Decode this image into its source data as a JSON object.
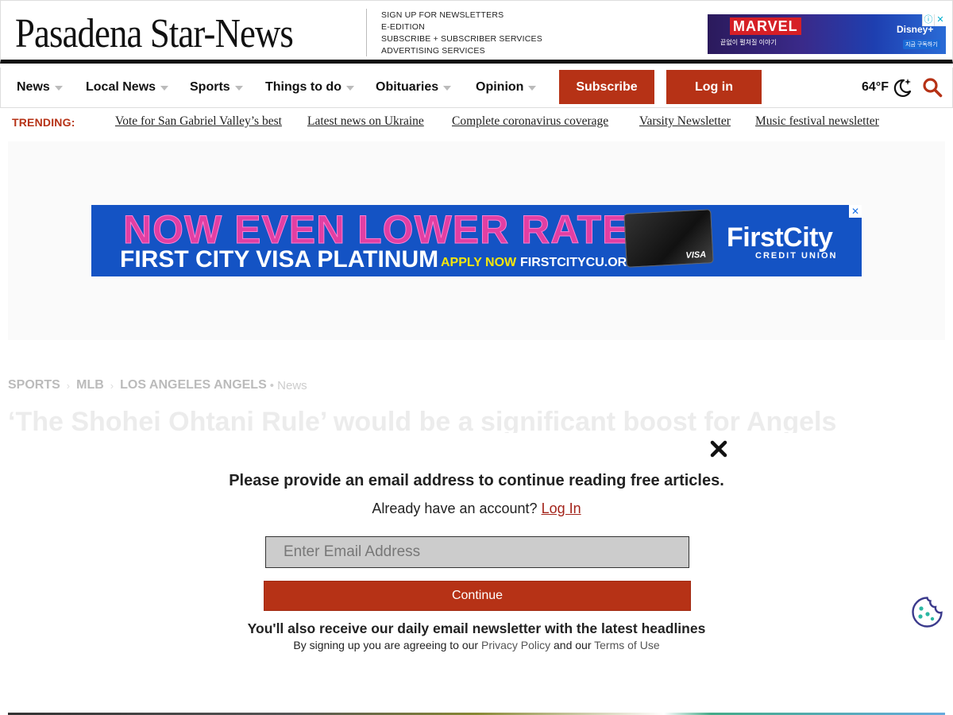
{
  "masthead": {
    "logo": "Pasadena Star-News",
    "links": [
      "SIGN UP FOR NEWSLETTERS",
      "E-EDITION",
      "SUBSCRIBE + SUBSCRIBER SERVICES",
      "ADVERTISING SERVICES"
    ],
    "top_ad": {
      "brand": "MARVEL",
      "partner": "Disney+",
      "line1": "끝없이 펼쳐질 이야기",
      "cta": "지금 구독하기"
    }
  },
  "nav": {
    "items": [
      {
        "label": "News"
      },
      {
        "label": "Local News"
      },
      {
        "label": "Sports"
      },
      {
        "label": "Things to do"
      },
      {
        "label": "Obituaries"
      },
      {
        "label": "Opinion"
      }
    ],
    "subscribe_label": "Subscribe",
    "login_label": "Log in",
    "weather": "64°F"
  },
  "trending": {
    "label": "TRENDING:",
    "links": [
      "Vote for San Gabriel Valley’s best",
      "Latest news on Ukraine",
      "Complete coronavirus coverage",
      "Varsity Newsletter",
      "Music festival newsletter"
    ]
  },
  "banner_ad": {
    "headline": "NOW EVEN LOWER RATES",
    "subline": "FIRST CITY VISA PLATINUM",
    "apply": "APPLY NOW",
    "url": "FIRSTCITYCU.ORG",
    "card_mark": "VISA",
    "brand": "FirstCity",
    "brand_sub": "CREDIT UNION"
  },
  "breadcrumb": {
    "items": [
      "SPORTS",
      "MLB",
      "LOS ANGELES ANGELS"
    ],
    "type": "• News"
  },
  "article": {
    "title": "‘The Shohei Ohtani Rule’ would be a significant boost for Angels"
  },
  "modal": {
    "heading": "Please provide an email address to continue reading free articles.",
    "account_prompt": "Already have an account?",
    "login_link": "Log In",
    "email_placeholder": "Enter Email Address",
    "continue_label": "Continue",
    "newsletter_note": "You'll also receive our daily email newsletter with the latest headlines",
    "terms_prefix": "By signing up you are agreeing to our",
    "privacy_link": "Privacy Policy",
    "terms_mid": "and our",
    "terms_link": "Terms of Use"
  },
  "colors": {
    "accent_red": "#b63216",
    "link_red": "#a3231a",
    "banner_blue": "#1453c4"
  },
  "icons": [
    "moon-stars-icon",
    "search-icon",
    "close-icon",
    "cookie-icon",
    "caret-down-icon"
  ]
}
